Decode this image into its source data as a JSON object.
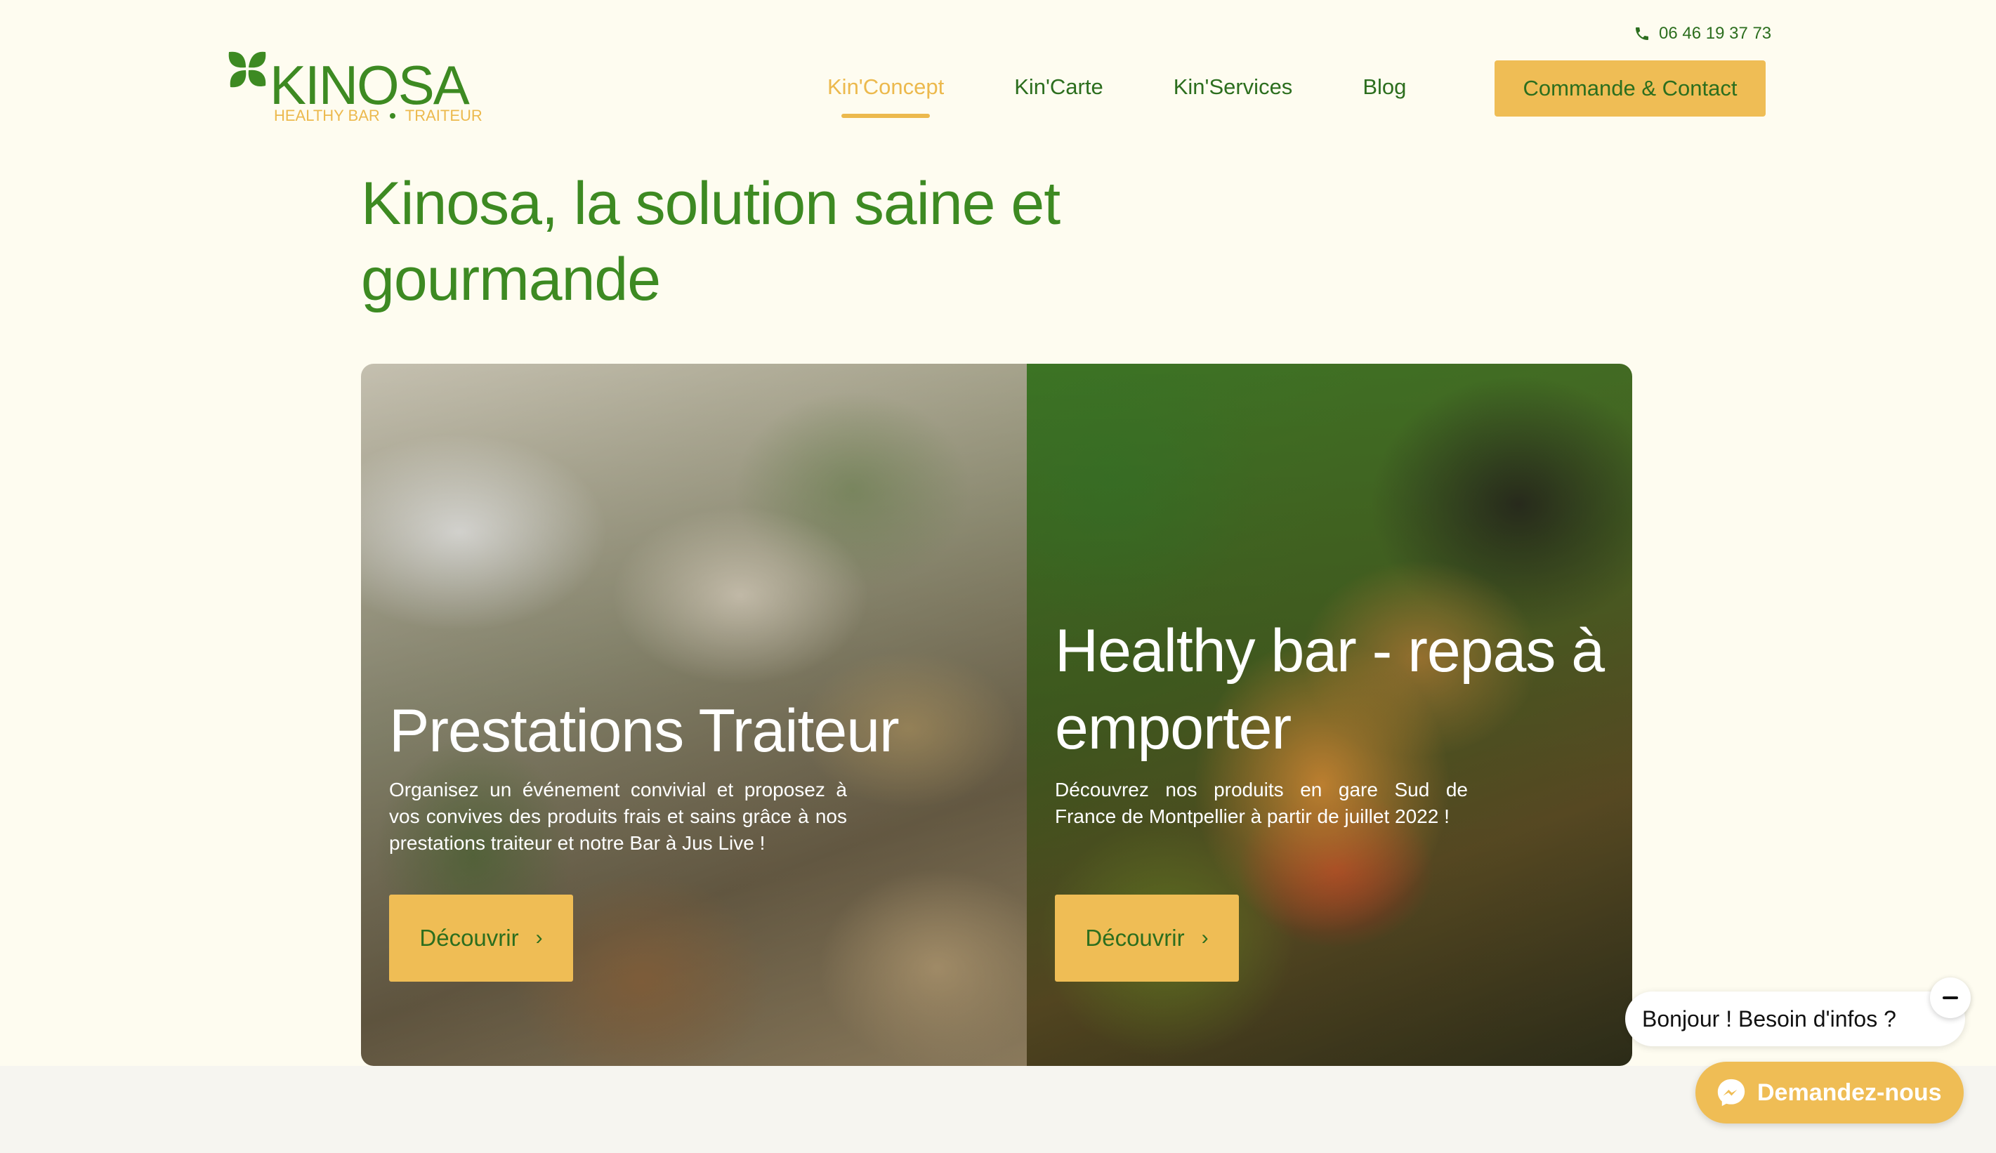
{
  "header": {
    "phone": "06 46 19 37 73",
    "phone_icon": "phone-icon",
    "logo": {
      "name": "KINOSA",
      "tagline_left": "HEALTHY BAR",
      "tagline_right": "TRAITEUR"
    },
    "nav": [
      {
        "label": "Kin'Concept",
        "active": true
      },
      {
        "label": "Kin'Carte",
        "active": false
      },
      {
        "label": "Kin'Services",
        "active": false
      },
      {
        "label": "Blog",
        "active": false
      }
    ],
    "cta": "Commande & Contact"
  },
  "hero": {
    "title": "Kinosa, la solution saine et gourmande"
  },
  "cards": [
    {
      "title": "Prestations Traiteur",
      "text": "Organisez un événement convivial et proposez à vos convives des produits frais et sains grâce à nos prestations traiteur et notre Bar à Jus Live !",
      "button": "Découvrir",
      "button_icon": "chevron-right-icon"
    },
    {
      "title": "Healthy bar - repas à emporter",
      "text": "Découvrez nos produits en gare Sud de France de Montpellier à partir de juillet 2022 !",
      "button": "Découvrir",
      "button_icon": "chevron-right-icon"
    }
  ],
  "chat": {
    "greeting": "Bonjour ! Besoin d'infos ?",
    "button": "Demandez-nous",
    "close_icon": "minus-icon",
    "messenger_icon": "messenger-icon"
  },
  "colors": {
    "background": "#fefcf0",
    "brand_green": "#3d8a22",
    "dark_green": "#2c6e1e",
    "accent_yellow": "#efbd55"
  }
}
